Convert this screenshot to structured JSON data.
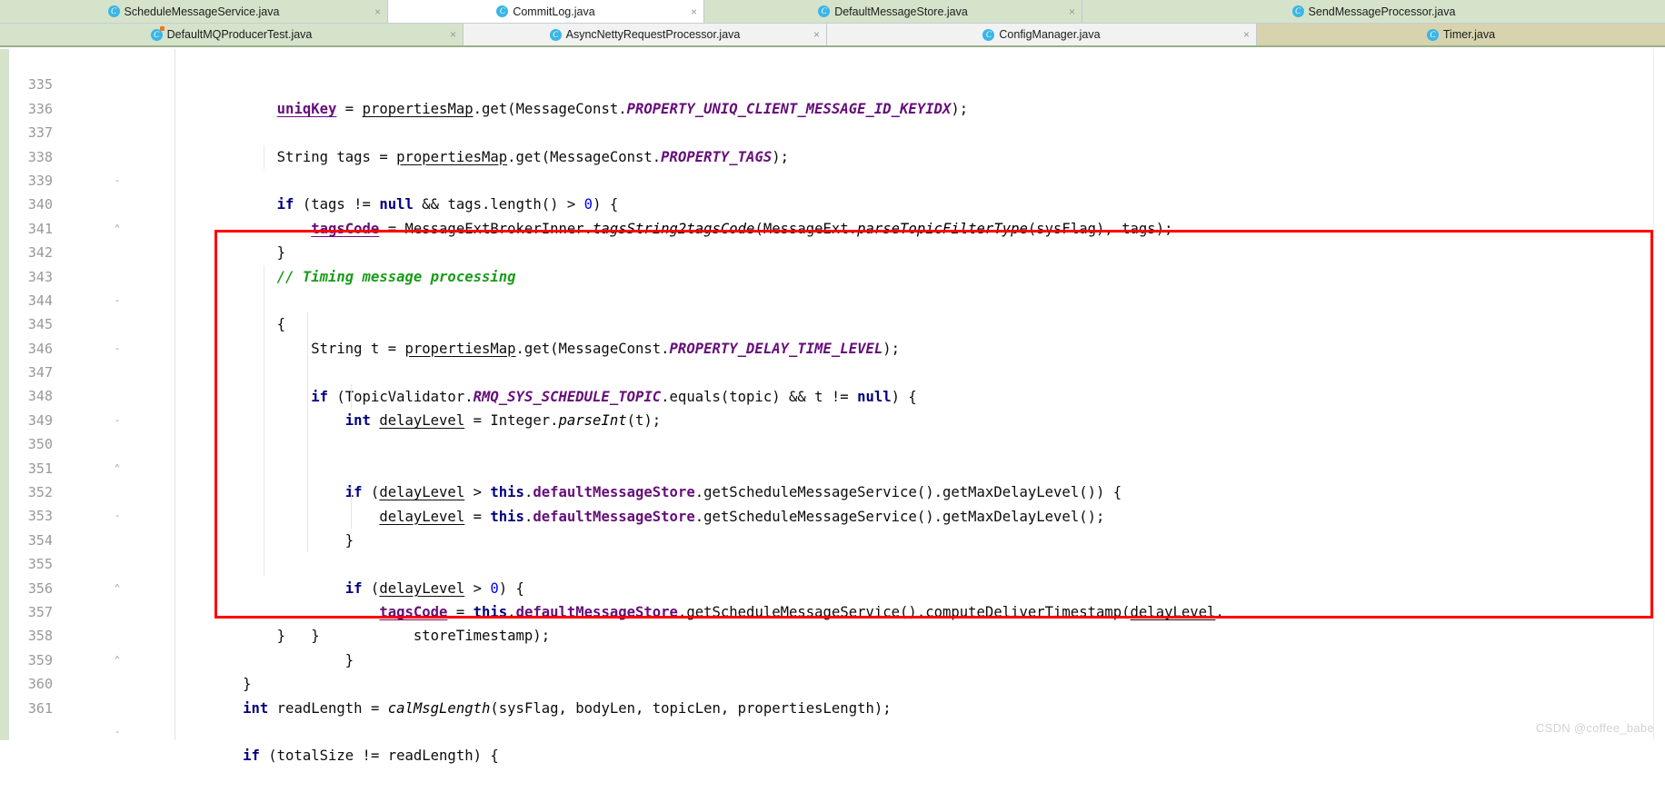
{
  "tabs": {
    "row1": [
      {
        "label": "ScheduleMessageService.java",
        "icon": "java-class-icon",
        "close": "×",
        "style": "greenbg",
        "active": false,
        "closable": true
      },
      {
        "label": "CommitLog.java",
        "icon": "java-class-icon",
        "close": "×",
        "style": "whitebg",
        "active": true,
        "closable": true
      },
      {
        "label": "DefaultMessageStore.java",
        "icon": "java-class-icon",
        "close": "×",
        "style": "greenbg",
        "active": false,
        "closable": true
      },
      {
        "label": "SendMessageProcessor.java",
        "icon": "java-class-icon",
        "close": "",
        "style": "greenbg",
        "active": false,
        "closable": false
      }
    ],
    "row2": [
      {
        "label": "DefaultMQProducerTest.java",
        "icon": "java-test-class-icon",
        "close": "×",
        "style": "greenbg",
        "active": false,
        "closable": true
      },
      {
        "label": "AsyncNettyRequestProcessor.java",
        "icon": "java-class-icon",
        "close": "×",
        "style": "graybg",
        "active": false,
        "closable": true
      },
      {
        "label": "ConfigManager.java",
        "icon": "java-class-icon",
        "close": "×",
        "style": "graybg",
        "active": false,
        "closable": true
      },
      {
        "label": "Timer.java",
        "icon": "java-class-icon",
        "close": "",
        "style": "khaki",
        "active": false,
        "closable": false
      }
    ]
  },
  "editor": {
    "file": "CommitLog.java",
    "first_line_number": 335,
    "last_line_number": 361,
    "lines": [
      {
        "n": "335",
        "fold": "",
        "indent": 0,
        "text": "            uniqKey = propertiesMap.get(MessageConst.PROPERTY_UNIQ_CLIENT_MESSAGE_ID_KEYIDX);"
      },
      {
        "n": "336",
        "fold": "",
        "indent": 0,
        "text": ""
      },
      {
        "n": "337",
        "fold": "",
        "indent": 0,
        "text": "            String tags = propertiesMap.get(MessageConst.PROPERTY_TAGS);"
      },
      {
        "n": "338",
        "fold": "-",
        "indent": 0,
        "text": "            if (tags != null && tags.length() > 0) {"
      },
      {
        "n": "339",
        "fold": "",
        "indent": 0,
        "text": "                tagsCode = MessageExtBrokerInner.tagsString2tagsCode(MessageExt.parseTopicFilterType(sysFlag), tags);"
      },
      {
        "n": "340",
        "fold": "⌃",
        "indent": 0,
        "text": "            }"
      },
      {
        "n": "341",
        "fold": "",
        "indent": 0,
        "text": ""
      },
      {
        "n": "342",
        "fold": "",
        "indent": 0,
        "text": "            // Timing message processing"
      },
      {
        "n": "343",
        "fold": "-",
        "indent": 0,
        "text": "            {"
      },
      {
        "n": "344",
        "fold": "",
        "indent": 0,
        "text": "                String t = propertiesMap.get(MessageConst.PROPERTY_DELAY_TIME_LEVEL);"
      },
      {
        "n": "345",
        "fold": "-",
        "indent": 0,
        "text": "                if (TopicValidator.RMQ_SYS_SCHEDULE_TOPIC.equals(topic) && t != null) {"
      },
      {
        "n": "346",
        "fold": "",
        "indent": 0,
        "text": "                    int delayLevel = Integer.parseInt(t);"
      },
      {
        "n": "347",
        "fold": "",
        "indent": 0,
        "text": ""
      },
      {
        "n": "348",
        "fold": "-",
        "indent": 0,
        "text": "                    if (delayLevel > this.defaultMessageStore.getScheduleMessageService().getMaxDelayLevel()) {"
      },
      {
        "n": "349",
        "fold": "",
        "indent": 0,
        "text": "                        delayLevel = this.defaultMessageStore.getScheduleMessageService().getMaxDelayLevel();"
      },
      {
        "n": "350",
        "fold": "⌃",
        "indent": 0,
        "text": "                    }"
      },
      {
        "n": "351",
        "fold": "",
        "indent": 0,
        "text": ""
      },
      {
        "n": "352",
        "fold": "-",
        "indent": 0,
        "text": "                    if (delayLevel > 0) {"
      },
      {
        "n": "353",
        "fold": "",
        "indent": 0,
        "text": "                        tagsCode = this.defaultMessageStore.getScheduleMessageService().computeDeliverTimestamp(delayLevel,"
      },
      {
        "n": "354",
        "fold": "",
        "indent": 0,
        "text": "                            storeTimestamp);"
      },
      {
        "n": "355",
        "fold": "⌃",
        "indent": 0,
        "text": "                    }"
      },
      {
        "n": "356",
        "fold": "",
        "indent": 0,
        "text": "                }"
      },
      {
        "n": "357",
        "fold": "",
        "indent": 0,
        "text": "            }"
      },
      {
        "n": "358",
        "fold": "⌃",
        "indent": 0,
        "text": "        }"
      },
      {
        "n": "359",
        "fold": "",
        "indent": 0,
        "text": ""
      },
      {
        "n": "360",
        "fold": "",
        "indent": 0,
        "text": "        int readLength = calMsgLength(sysFlag, bodyLen, topicLen, propertiesLength);"
      },
      {
        "n": "361",
        "fold": "-",
        "indent": 0,
        "text": "        if (totalSize != readLength) {"
      }
    ]
  },
  "annotation": {
    "highlight_box": {
      "color": "#ff0000",
      "covers_lines": "342-358"
    }
  },
  "watermark": "CSDN @coffee_babe",
  "colors": {
    "keyword": "#000080",
    "number": "#0000ff",
    "field": "#660e7a",
    "constant": "#660e7a",
    "comment": "#1a9a1a",
    "highlight": "#ff0000",
    "tab_active_bg": "#ffffff",
    "tab_inactive_bg": "#d6e3cb",
    "tab_timer_bg": "#d6d3ae"
  }
}
